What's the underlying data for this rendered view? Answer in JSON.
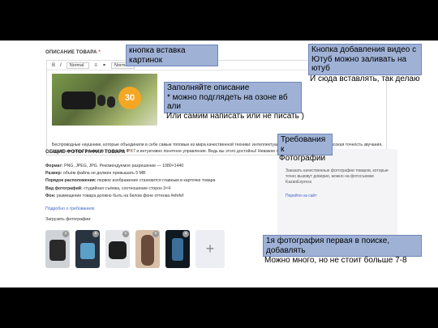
{
  "description": {
    "section_title": "ОПИСАНИЕ ТОВАРА",
    "required_mark": "*",
    "toolbar": {
      "format_normal_1": "Normal",
      "format_normal_2": "Normal"
    },
    "image_badge": "30",
    "text": "Беспроводные наушники, которые объединили в себе самые топовые из мира качественной техники: интеллектуальное шумоподавление и высокая точность звучания, защита от влаги и пыли по стандарту IPX7 и интуитивно понятное управление. Ведь вы этого достойны! Неважно путешествие"
  },
  "photos": {
    "section_title": "ОБЩИЕ ФОТОГРАФИИ ТОВАРА",
    "required_mark": "*",
    "specs": [
      {
        "label": "Формат:",
        "value": "PNG, JPEG, JPG. Рекомендуемое разрешение — 1080×1440"
      },
      {
        "label": "Размер:",
        "value": "объём файла не должен превышать 5 MB"
      },
      {
        "label": "Порядок расположения:",
        "value": "первое изображение становится главным в карточке товара"
      },
      {
        "label": "Вид фотографий:",
        "value": "студийная съёмка, соотношение сторон 3×4"
      },
      {
        "label": "Фон:",
        "value": "размещение товара должно быть на белом фоне оттенка #efefef"
      }
    ],
    "requirements_link": "Подробно о требованиях",
    "upload_label": "Загрузить фотографии:",
    "add_symbol": "+",
    "remove_symbol": "×"
  },
  "panel": {
    "text": "Заказать качественные фотографии товаров, которые точно вызовут доверие, можно на фотосъемки KazanExpress",
    "link": "Перейти на сайт"
  },
  "notes": {
    "image_button": "кнопка вставка картинок",
    "video_button": "Кнопка добавления видео с Ютуб можно заливать на ютуб",
    "video_tail": "И сюда вставлять, так делаю",
    "description_fill_1": "Заполняйте описание",
    "description_fill_2": "* можно подглядеть на озоне вб али",
    "description_tail": "Или самим написать или не писать )",
    "requirements": "Требования к",
    "requirements_tail": "Фотографии",
    "first_photo": "1я фотография первая в поиске, добавлять",
    "first_photo_tail": "Можно много, но не стоит больше 7-8"
  }
}
